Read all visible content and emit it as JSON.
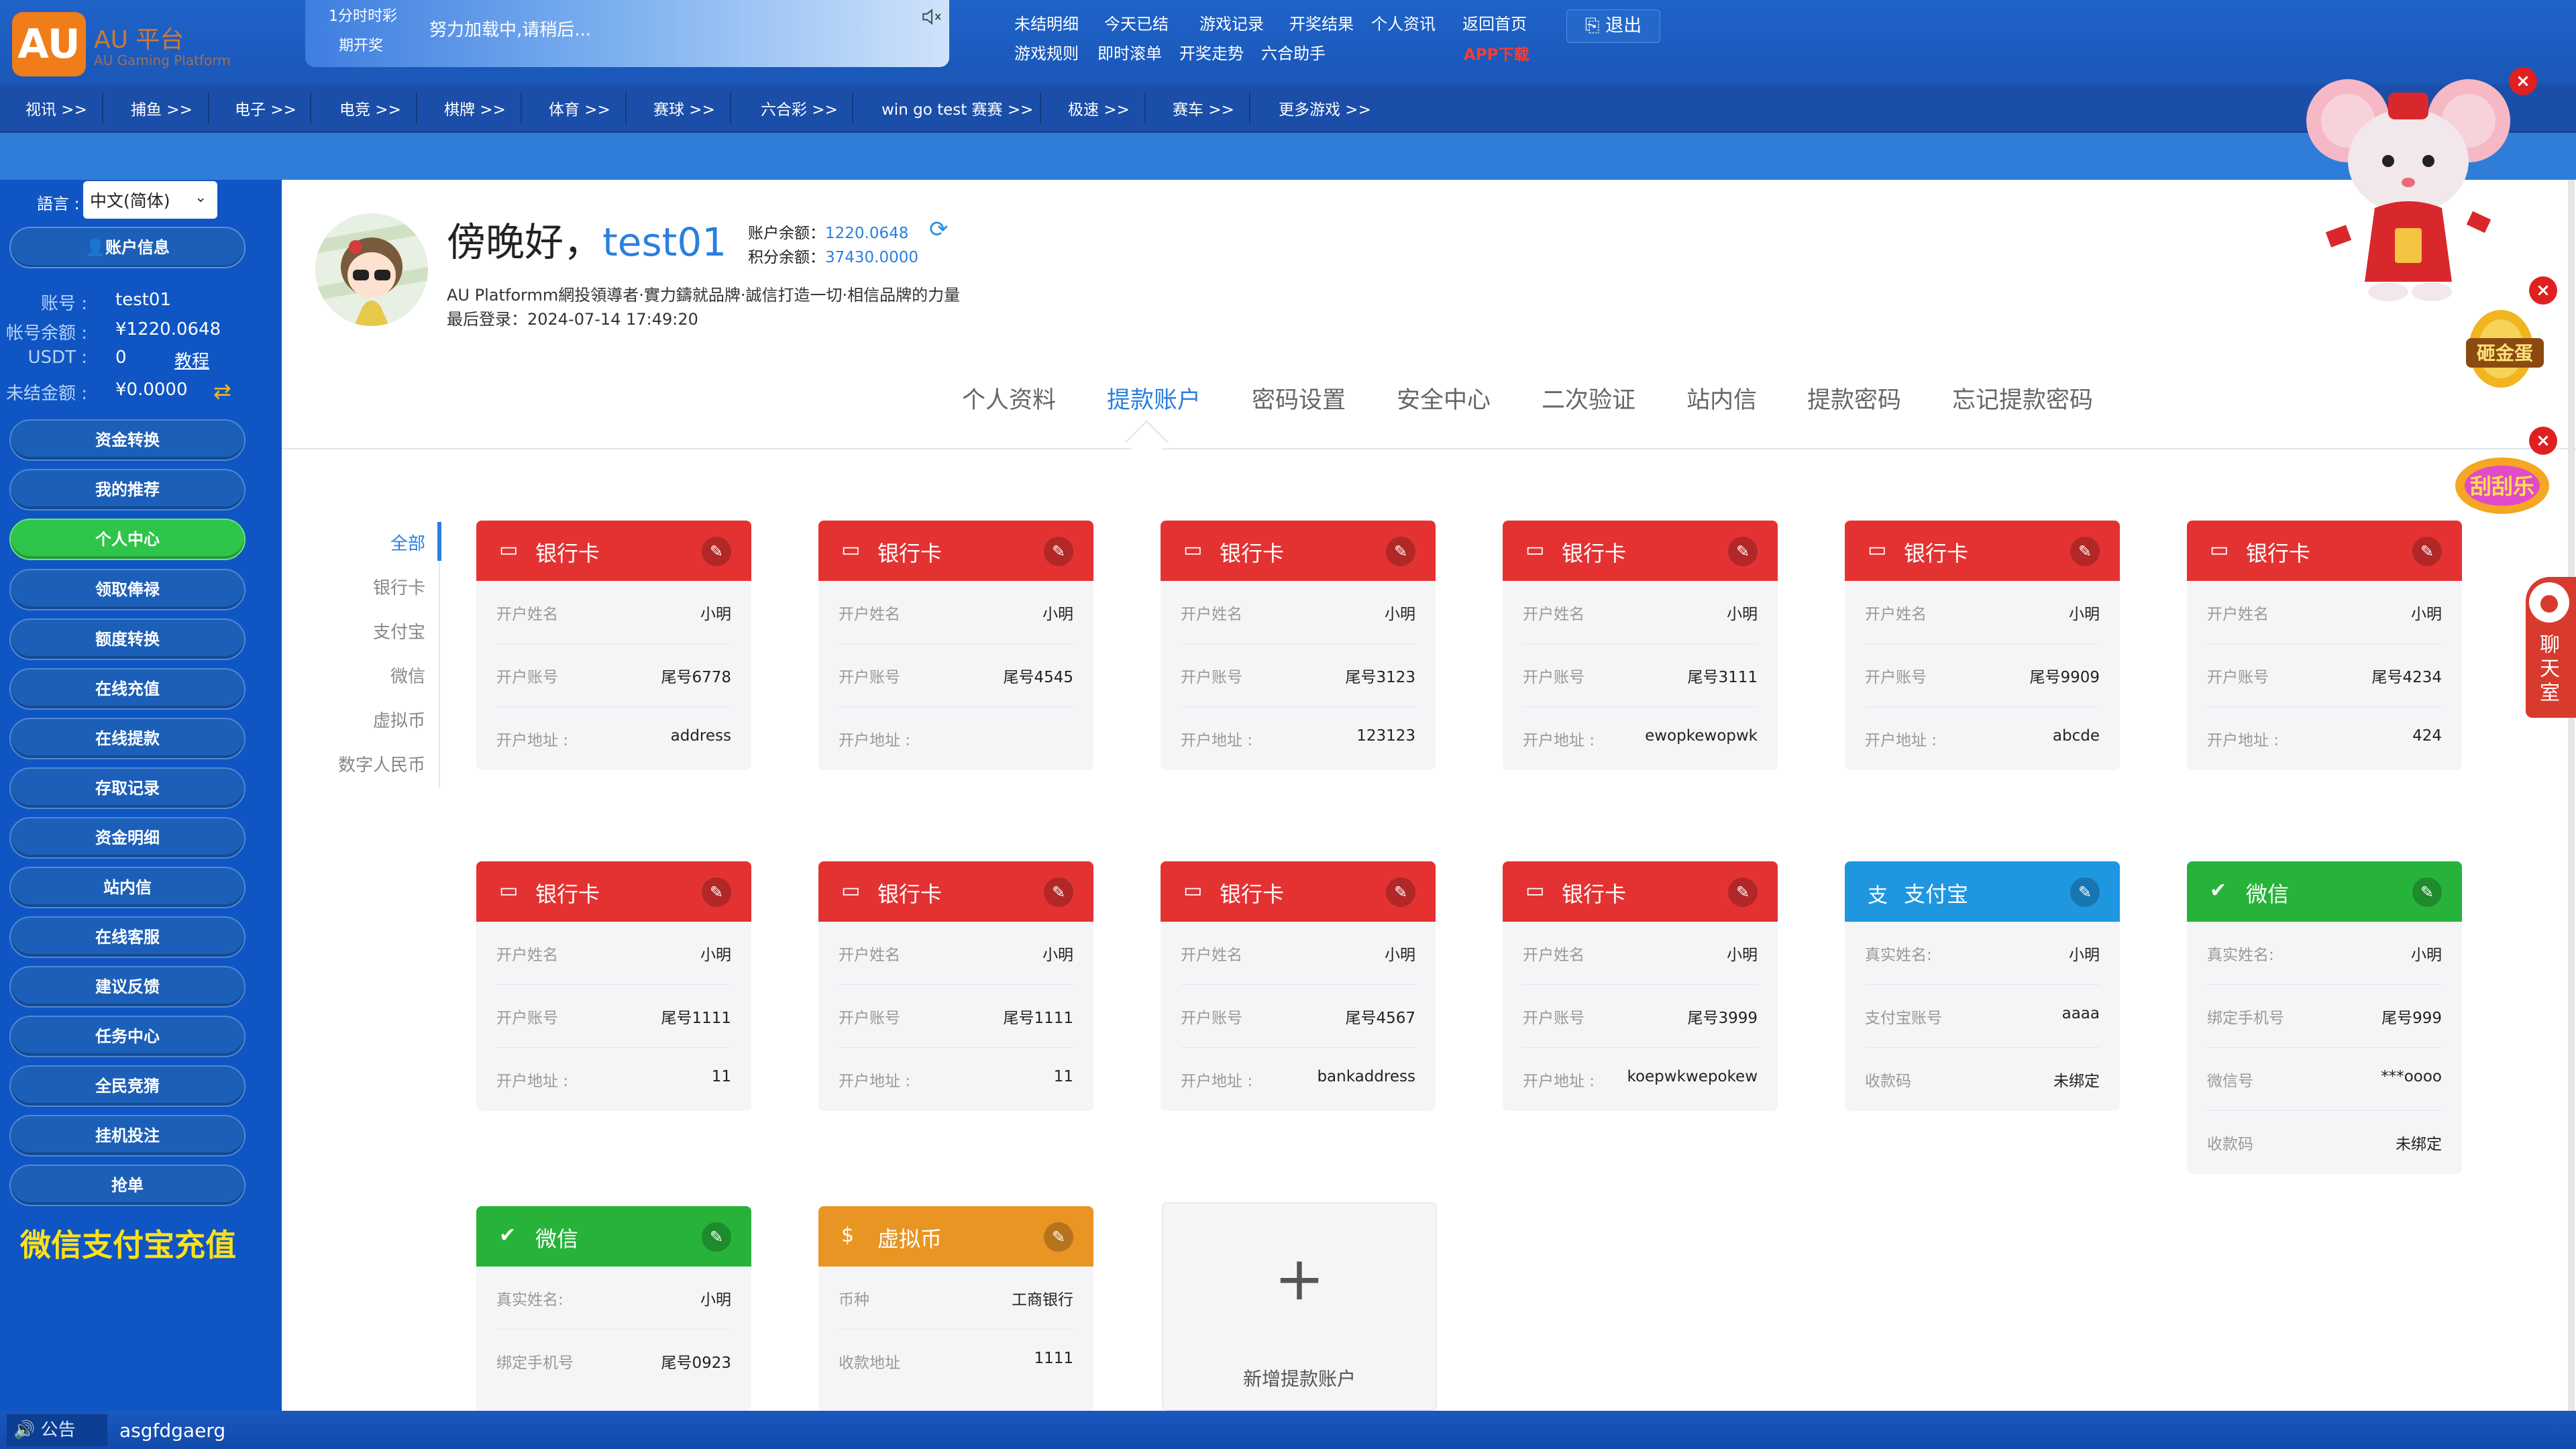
{
  "header": {
    "logo_text": "AU",
    "logo_name": "AU 平台",
    "logo_tagline": "AU Gaming Platform",
    "lottery_name": "1分时时彩",
    "lottery_period": "期开奖",
    "lottery_status": "努力加载中,请稍后...",
    "links_row1": [
      "未结明细",
      "今天已结",
      "游戏记录",
      "开奖结果",
      "个人资讯",
      "返回首页"
    ],
    "links_row2": [
      "游戏规则",
      "即时滚单",
      "开奖走势",
      "六合助手"
    ],
    "app_download": "APP下载",
    "logout": "退出"
  },
  "nav": [
    "视讯 >>",
    "捕鱼 >>",
    "电子 >>",
    "电竞 >>",
    "棋牌 >>",
    "体育 >>",
    "赛球 >>",
    "六合彩 >>",
    "win go test 赛赛 >>",
    "极速 >>",
    "赛车 >>",
    "更多游戏 >>"
  ],
  "sidebar": {
    "language_label": "語言 :",
    "language_value": "中文(简体)",
    "account_button": "账户信息",
    "account": {
      "username_label": "账号 :",
      "username": "test01",
      "balance_label": "帐号余额 :",
      "balance": "¥1220.0648",
      "usdt_label": "USDT :",
      "usdt": "0",
      "tutorial": "教程",
      "unsettled_label": "未结金额 :",
      "unsettled": "¥0.0000"
    },
    "menu": [
      "资金转换",
      "我的推荐",
      "个人中心",
      "领取俸禄",
      "额度转换",
      "在线充值",
      "在线提款",
      "存取记录",
      "资金明细",
      "站内信",
      "在线客服",
      "建议反馈",
      "任务中心",
      "全民竞猜",
      "挂机投注",
      "抢单"
    ],
    "active_menu": "个人中心",
    "promo": "微信支付宝充值"
  },
  "profile": {
    "greeting": "傍晚好，",
    "username": "test01",
    "balance_label": "账户余额：",
    "balance": "1220.0648",
    "points_label": "积分余额：",
    "points": "37430.0000",
    "slogan": "AU Platformm網投領導者·實力鑄就品牌·誠信打造一切·相信品牌的力量",
    "last_login": "最后登录：2024-07-14 17:49:20"
  },
  "tabs": [
    "个人资料",
    "提款账户",
    "密码设置",
    "安全中心",
    "二次验证",
    "站内信",
    "提款密码",
    "忘记提款密码"
  ],
  "active_tab": "提款账户",
  "filters": [
    "全部",
    "银行卡",
    "支付宝",
    "微信",
    "虚拟币",
    "数字人民币"
  ],
  "active_filter": "全部",
  "cards": [
    {
      "type": "银行卡",
      "rows": [
        [
          "开户姓名",
          "小明"
        ],
        [
          "开户账号",
          "尾号6778"
        ],
        [
          "开户地址 :",
          "address"
        ]
      ]
    },
    {
      "type": "银行卡",
      "rows": [
        [
          "开户姓名",
          "小明"
        ],
        [
          "开户账号",
          "尾号4545"
        ],
        [
          "开户地址 :",
          ""
        ]
      ]
    },
    {
      "type": "银行卡",
      "rows": [
        [
          "开户姓名",
          "小明"
        ],
        [
          "开户账号",
          "尾号3123"
        ],
        [
          "开户地址 :",
          "123123"
        ]
      ]
    },
    {
      "type": "银行卡",
      "rows": [
        [
          "开户姓名",
          "小明"
        ],
        [
          "开户账号",
          "尾号3111"
        ],
        [
          "开户地址 :",
          "ewopkewopwk"
        ]
      ]
    },
    {
      "type": "银行卡",
      "rows": [
        [
          "开户姓名",
          "小明"
        ],
        [
          "开户账号",
          "尾号9909"
        ],
        [
          "开户地址 :",
          "abcde"
        ]
      ]
    },
    {
      "type": "银行卡",
      "rows": [
        [
          "开户姓名",
          "小明"
        ],
        [
          "开户账号",
          "尾号4234"
        ],
        [
          "开户地址 :",
          "424"
        ]
      ]
    },
    {
      "type": "银行卡",
      "rows": [
        [
          "开户姓名",
          "小明"
        ],
        [
          "开户账号",
          "尾号1111"
        ],
        [
          "开户地址 :",
          "11"
        ]
      ]
    },
    {
      "type": "银行卡",
      "rows": [
        [
          "开户姓名",
          "小明"
        ],
        [
          "开户账号",
          "尾号1111"
        ],
        [
          "开户地址 :",
          "11"
        ]
      ]
    },
    {
      "type": "银行卡",
      "rows": [
        [
          "开户姓名",
          "小明"
        ],
        [
          "开户账号",
          "尾号4567"
        ],
        [
          "开户地址 :",
          "bankaddress"
        ]
      ]
    },
    {
      "type": "银行卡",
      "rows": [
        [
          "开户姓名",
          "小明"
        ],
        [
          "开户账号",
          "尾号3999"
        ],
        [
          "开户地址 :",
          "koepwkwepokew"
        ]
      ]
    },
    {
      "type": "支付宝",
      "rows": [
        [
          "真实姓名:",
          "小明"
        ],
        [
          "支付宝账号",
          "aaaa"
        ],
        [
          "收款码",
          "未绑定"
        ]
      ]
    },
    {
      "type": "微信",
      "rows": [
        [
          "真实姓名:",
          "小明"
        ],
        [
          "绑定手机号",
          "尾号999"
        ],
        [
          "微信号",
          "***oooo"
        ],
        [
          "收款码",
          "未绑定"
        ]
      ]
    },
    {
      "type": "微信",
      "rows": [
        [
          "真实姓名:",
          "小明"
        ],
        [
          "绑定手机号",
          "尾号0923"
        ]
      ]
    },
    {
      "type": "虚拟币",
      "rows": [
        [
          "币种",
          "工商银行"
        ],
        [
          "收款地址",
          "1111"
        ]
      ]
    }
  ],
  "add_card_label": "新增提款账户",
  "colors": {
    "bank": "#e43232",
    "alipay": "#1e96e0",
    "wechat": "#27b33a",
    "crypto": "#e89524",
    "accent": "#2a7fe0"
  },
  "floats": {
    "chat": "聊天室",
    "promo1": "砸金蛋",
    "promo2": "刮刮乐"
  },
  "footer": {
    "notice_label": "公告",
    "notice_text": "asgfdgaerg"
  }
}
